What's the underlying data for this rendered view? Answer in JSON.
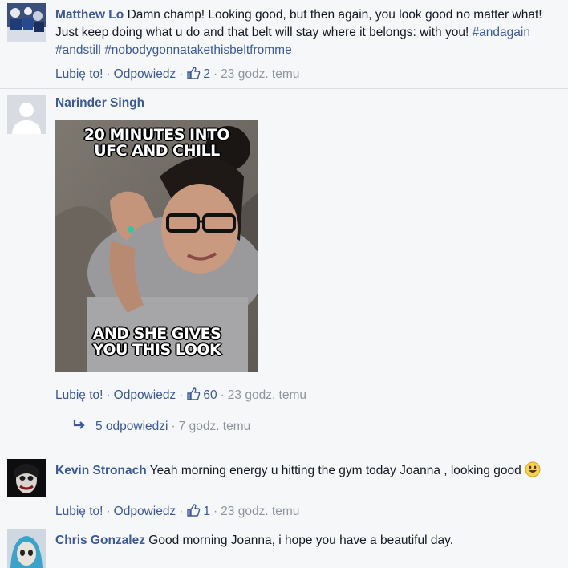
{
  "comments": [
    {
      "author": "Matthew Lo",
      "text": "Damn champ! Looking good, but then again, you look good no matter what! Just keep doing what u do and that belt will stay where it belongs: with you!",
      "hashtags": [
        "#andagain",
        "#andstill",
        "#nobodygonnatakethisbeltfromme"
      ],
      "like_label": "Lubię to!",
      "reply_label": "Odpowiedz",
      "like_count": "2",
      "time": "23 godz. temu"
    },
    {
      "author": "Narinder Singh",
      "image": {
        "top_text": [
          "20 MINUTES INTO",
          "UFC AND CHILL"
        ],
        "bottom_text": [
          "AND SHE GIVES",
          "YOU THIS LOOK"
        ]
      },
      "like_label": "Lubię to!",
      "reply_label": "Odpowiedz",
      "like_count": "60",
      "time": "23 godz. temu",
      "replies_label": "5 odpowiedzi",
      "replies_time": "7 godz. temu"
    },
    {
      "author": "Kevin Stronach",
      "text": "Yeah morning energy u hitting the gym today Joanna , looking good",
      "emoji": "smile-emoji",
      "like_label": "Lubię to!",
      "reply_label": "Odpowiedz",
      "like_count": "1",
      "time": "23 godz. temu"
    },
    {
      "author": "Chris Gonzalez",
      "text": "Good morning Joanna, i hope you have a beautiful day."
    }
  ],
  "colors": {
    "link": "#3b5998",
    "meta": "#90949c",
    "background": "#f6f7f9",
    "divider": "#dcdee3"
  }
}
